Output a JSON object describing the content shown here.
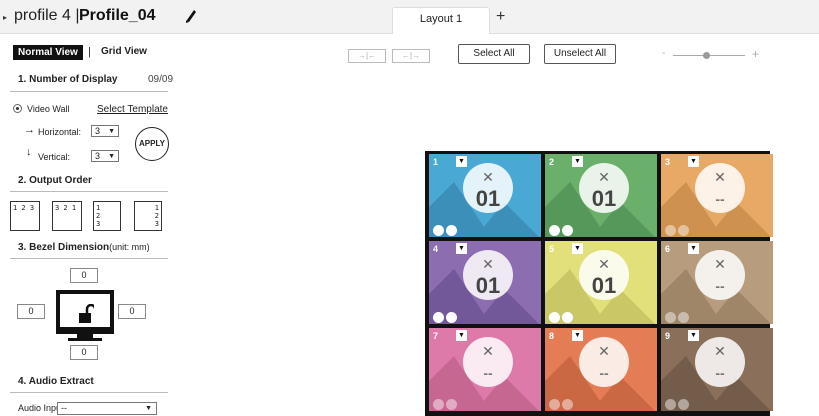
{
  "header": {
    "profile_label": "profile 4 |",
    "profile_name": "Profile_04",
    "tab_label": "Layout 1",
    "add_tab_label": "+"
  },
  "view": {
    "normal_label": "Normal View",
    "separator": "|",
    "grid_label": "Grid View"
  },
  "section1": {
    "title": "1. Number of Display",
    "count": "09/09",
    "video_wall_label": "Video Wall",
    "select_template_label": "Select Template",
    "horizontal_label": "Horizontal:",
    "horizontal_value": "3",
    "vertical_label": "Vertical:",
    "vertical_value": "3",
    "apply_label": "APPLY"
  },
  "section2": {
    "title": "2. Output Order",
    "order_options": [
      "1 2 3",
      "3 2 1",
      "1\n2\n3",
      "1\n2\n3"
    ]
  },
  "section3": {
    "title": "3. Bezel Dimension",
    "unit": "(unit: mm)",
    "top": "0",
    "left": "0",
    "right": "0",
    "bottom": "0"
  },
  "section4": {
    "title": "4. Audio Extract",
    "audio_input_label": "Audio Input",
    "audio_input_value": "--"
  },
  "toolbar": {
    "select_all_label": "Select All",
    "unselect_all_label": "Unselect All",
    "zoom_minus": "-",
    "zoom_plus": "+"
  },
  "wall": {
    "cells": [
      {
        "id": "1",
        "label": "01",
        "color": "#4aa8d4",
        "mount": "#3b8fb8",
        "active": true
      },
      {
        "id": "2",
        "label": "01",
        "color": "#6aaf6a",
        "mount": "#56975a",
        "active": true
      },
      {
        "id": "3",
        "label": "--",
        "color": "#e8a966",
        "mount": "#cf9150",
        "active": false
      },
      {
        "id": "4",
        "label": "01",
        "color": "#8b6db0",
        "mount": "#735899",
        "active": true
      },
      {
        "id": "5",
        "label": "01",
        "color": "#e2e07a",
        "mount": "#c9c766",
        "active": true
      },
      {
        "id": "6",
        "label": "--",
        "color": "#b79d7e",
        "mount": "#9f8668",
        "active": false
      },
      {
        "id": "7",
        "label": "--",
        "color": "#de7aaa",
        "mount": "#c66792",
        "active": false
      },
      {
        "id": "8",
        "label": "--",
        "color": "#e47c55",
        "mount": "#cb6844",
        "active": false
      },
      {
        "id": "9",
        "label": "--",
        "color": "#8a6f5b",
        "mount": "#745c4a",
        "active": false
      }
    ]
  },
  "colors": {
    "wall_border": "#111111",
    "topbar_bg": "#f2f2f2"
  }
}
